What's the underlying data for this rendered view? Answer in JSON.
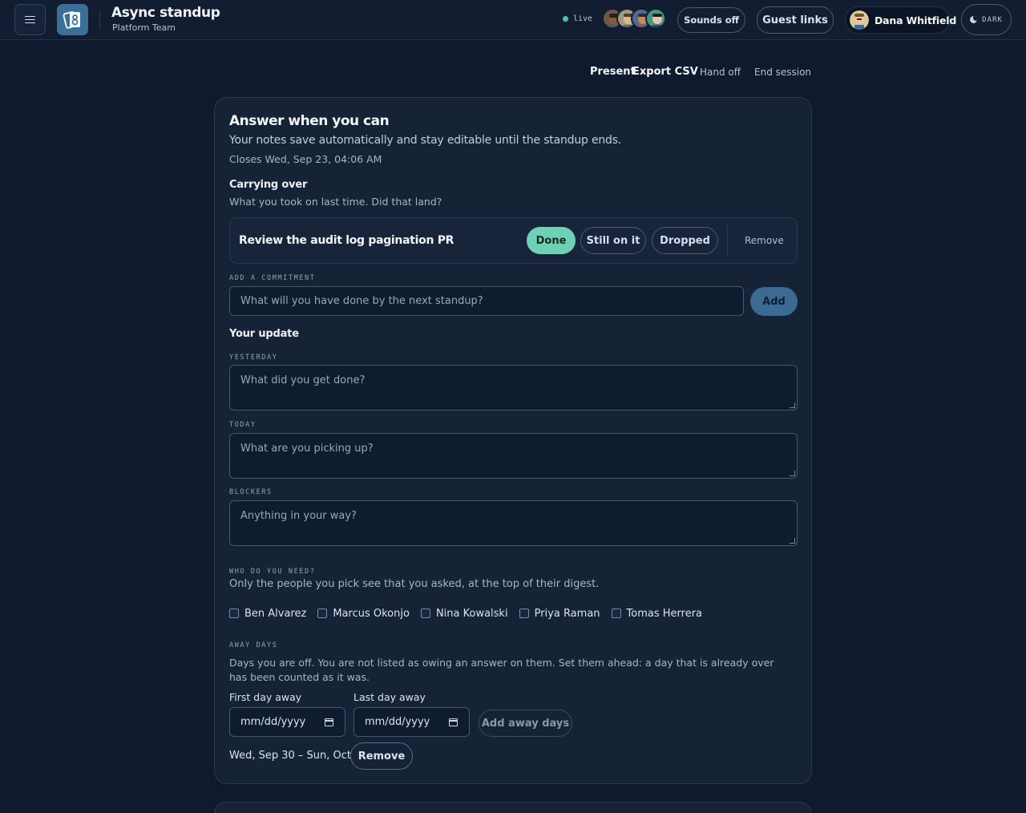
{
  "header": {
    "app_title": "Async standup",
    "team": "Platform Team",
    "live_label": "live",
    "sounds_label": "Sounds off",
    "guest_links_label": "Guest links",
    "user_name": "Dana Whitfield",
    "theme_label": "DARK"
  },
  "actions": {
    "present": "Present",
    "export": "Export CSV",
    "hand_off": "Hand off",
    "end_session": "End session"
  },
  "card": {
    "title": "Answer when you can",
    "subtitle": "Your notes save automatically and stay editable until the standup ends.",
    "closes": "Closes Wed, Sep 23, 04:06 AM",
    "carry": {
      "title": "Carrying over",
      "subtitle": "What you took on last time. Did that land?",
      "task": "Review the audit log pagination PR",
      "status_options": [
        "Done",
        "Still on it",
        "Dropped"
      ],
      "selected": "Done",
      "remove_label": "Remove"
    },
    "commitment": {
      "label": "ADD A COMMITMENT",
      "placeholder": "What will you have done by the next standup?",
      "add_label": "Add"
    },
    "update": {
      "title": "Your update",
      "yesterday_label": "YESTERDAY",
      "yesterday_placeholder": "What did you get done?",
      "today_label": "TODAY",
      "today_placeholder": "What are you picking up?",
      "blockers_label": "BLOCKERS",
      "blockers_placeholder": "Anything in your way?"
    },
    "who": {
      "label": "WHO DO YOU NEED?",
      "help": "Only the people you pick see that you asked, at the top of their digest.",
      "people": [
        "Ben Alvarez",
        "Marcus Okonjo",
        "Nina Kowalski",
        "Priya Raman",
        "Tomas Herrera"
      ]
    },
    "away": {
      "label": "AWAY DAYS",
      "help": "Days you are off. You are not listed as owing an answer on them. Set them ahead: a day that is already over has been counted as it was.",
      "first_label": "First day away",
      "last_label": "Last day away",
      "date_placeholder": "mm/dd/yyyy",
      "add_label": "Add away days",
      "range": "Wed, Sep 30 – Sun, Oct 4",
      "remove_label": "Remove"
    }
  },
  "colors": {
    "background": "#0f1a2e",
    "card": "#162236",
    "accent": "#6fd1b4",
    "primary_button": "#3b6b92"
  }
}
